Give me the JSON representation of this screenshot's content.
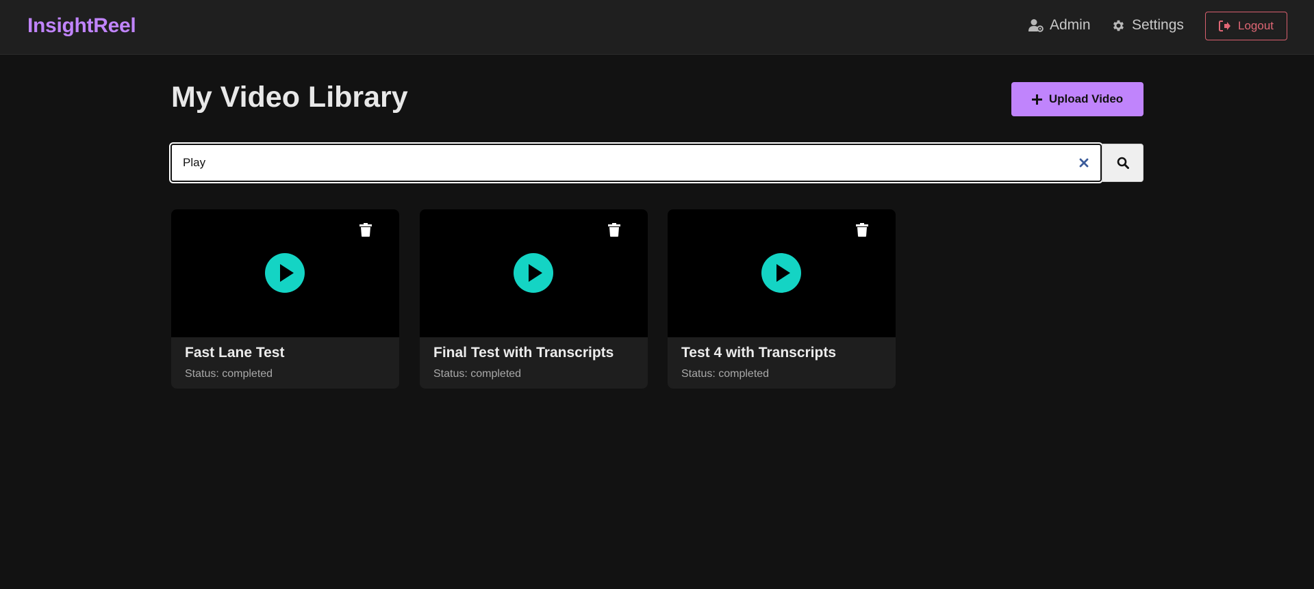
{
  "nav": {
    "brand": "InsightReel",
    "admin_label": "Admin",
    "settings_label": "Settings",
    "logout_label": "Logout"
  },
  "header": {
    "title": "My Video Library",
    "upload_label": "Upload Video"
  },
  "search": {
    "value": "Play",
    "placeholder": ""
  },
  "videos": [
    {
      "title": "Fast Lane Test",
      "status": "Status: completed"
    },
    {
      "title": "Final Test with Transcripts",
      "status": "Status: completed"
    },
    {
      "title": "Test 4 with Transcripts",
      "status": "Status: completed"
    }
  ],
  "colors": {
    "accent": "#c084fc",
    "play": "#14d4c4",
    "logout": "#e06775",
    "background": "#121212"
  },
  "icons": {
    "admin": "user-cog-icon",
    "settings": "gear-icon",
    "logout": "sign-out-icon",
    "upload": "plus-icon",
    "clear": "close-icon",
    "search": "search-icon",
    "play": "play-icon",
    "delete": "trash-icon"
  }
}
